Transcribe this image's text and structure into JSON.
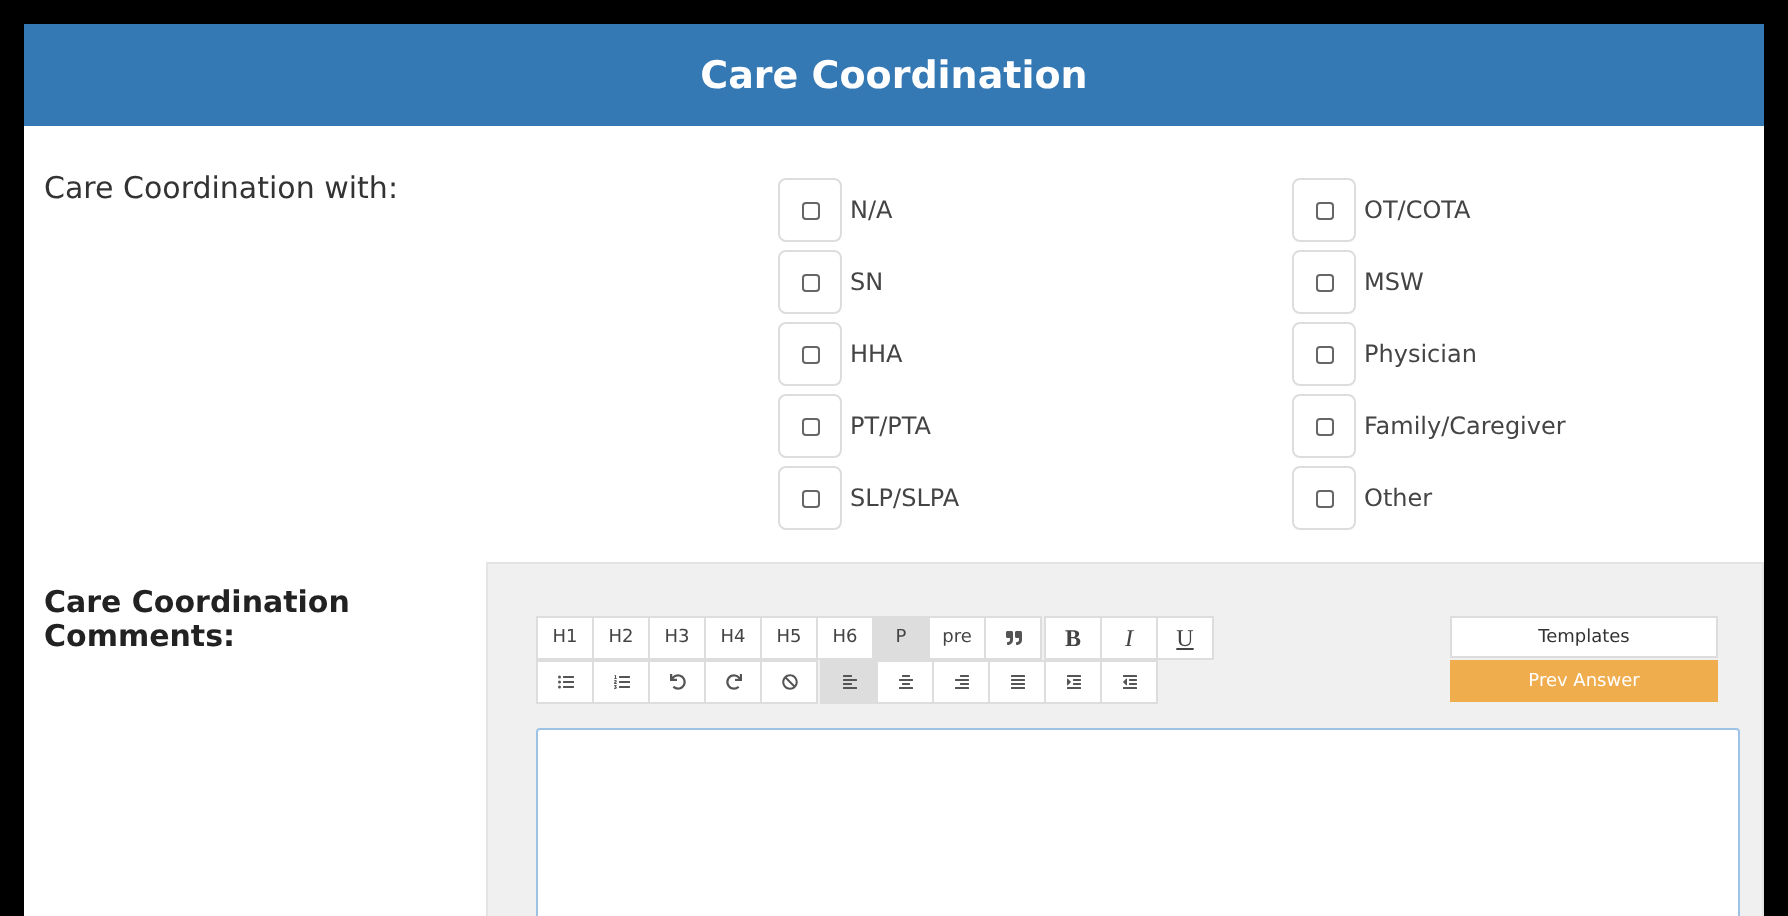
{
  "header": {
    "title": "Care Coordination"
  },
  "coordination": {
    "label": "Care Coordination with:",
    "columns": [
      [
        {
          "label": "N/A",
          "checked": false
        },
        {
          "label": "SN",
          "checked": false
        },
        {
          "label": "HHA",
          "checked": false
        },
        {
          "label": "PT/PTA",
          "checked": false
        },
        {
          "label": "SLP/SLPA",
          "checked": false
        }
      ],
      [
        {
          "label": "OT/COTA",
          "checked": false
        },
        {
          "label": "MSW",
          "checked": false
        },
        {
          "label": "Physician",
          "checked": false
        },
        {
          "label": "Family/Caregiver",
          "checked": false
        },
        {
          "label": "Other",
          "checked": false
        }
      ]
    ]
  },
  "comments": {
    "label": "Care Coordination Comments:",
    "toolbar_rows": [
      [
        [
          {
            "kind": "text",
            "label": "H1",
            "selected": false
          },
          {
            "kind": "text",
            "label": "H2",
            "selected": false
          },
          {
            "kind": "text",
            "label": "H3",
            "selected": false
          },
          {
            "kind": "text",
            "label": "H4",
            "selected": false
          },
          {
            "kind": "text",
            "label": "H5",
            "selected": false
          },
          {
            "kind": "text",
            "label": "H6",
            "selected": false
          },
          {
            "kind": "text",
            "label": "P",
            "selected": true
          },
          {
            "kind": "text",
            "label": "pre",
            "selected": false
          },
          {
            "kind": "icon",
            "selected": false
          }
        ],
        [
          {
            "kind": "bold",
            "label": "B",
            "selected": false
          },
          {
            "kind": "italic",
            "label": "I",
            "selected": false
          },
          {
            "kind": "underline",
            "label": "U",
            "selected": false
          }
        ]
      ],
      [
        [
          {
            "kind": "icon",
            "selected": false
          },
          {
            "kind": "icon",
            "selected": false
          },
          {
            "kind": "icon",
            "selected": false
          },
          {
            "kind": "icon",
            "selected": false
          },
          {
            "kind": "icon",
            "selected": false
          }
        ],
        [
          {
            "kind": "icon",
            "selected": true
          },
          {
            "kind": "icon",
            "selected": false
          },
          {
            "kind": "icon",
            "selected": false
          },
          {
            "kind": "icon",
            "selected": false
          },
          {
            "kind": "icon",
            "selected": false
          },
          {
            "kind": "icon",
            "selected": false
          }
        ]
      ]
    ],
    "buttons": [
      {
        "kind": "plain",
        "label": "Templates"
      },
      {
        "kind": "accent",
        "label": "Prev Answer"
      }
    ]
  }
}
